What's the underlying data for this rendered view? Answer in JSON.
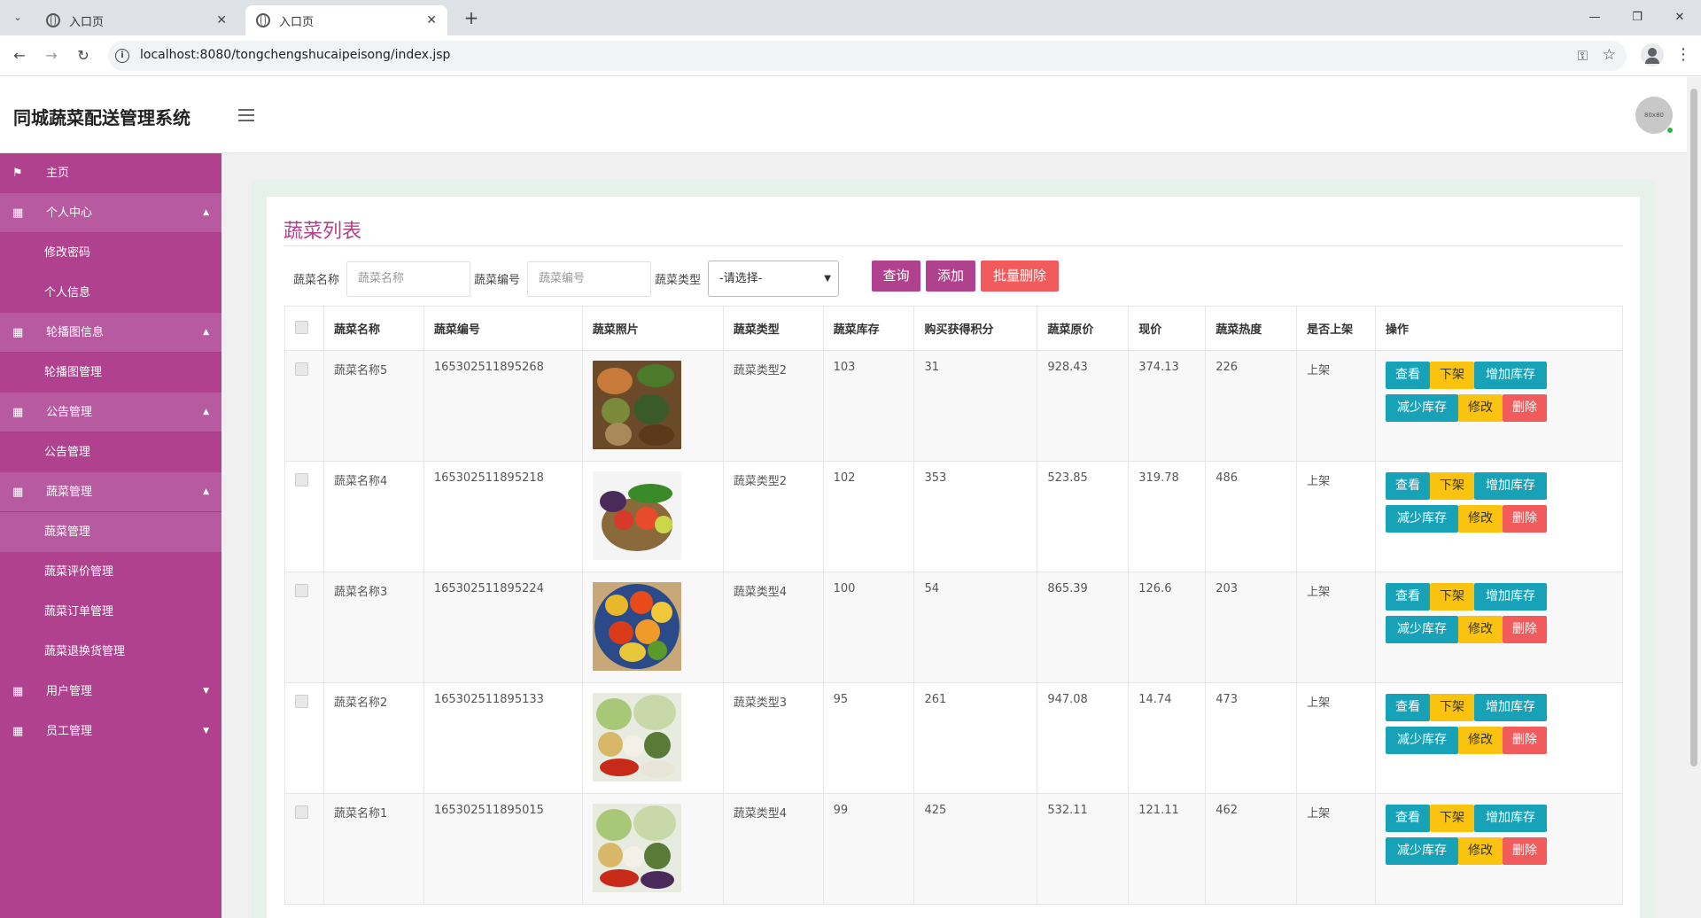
{
  "browser": {
    "tabs": [
      {
        "title": "入口页",
        "active": false
      },
      {
        "title": "入口页",
        "active": true
      }
    ],
    "url": "localhost:8080/tongchengshucaipeisong/index.jsp"
  },
  "header": {
    "title": "同城蔬菜配送管理系统",
    "avatar_text": "80x80"
  },
  "sidebar": {
    "home": "主页",
    "groups": [
      {
        "label": "个人中心",
        "items": [
          "修改密码",
          "个人信息"
        ]
      },
      {
        "label": "轮播图信息",
        "items": [
          "轮播图管理"
        ]
      },
      {
        "label": "公告管理",
        "items": [
          "公告管理"
        ]
      },
      {
        "label": "蔬菜管理",
        "items": [
          "蔬菜管理",
          "蔬菜评价管理",
          "蔬菜订单管理",
          "蔬菜退换货管理"
        ]
      },
      {
        "label": "用户管理",
        "items": []
      },
      {
        "label": "员工管理",
        "items": []
      }
    ]
  },
  "main": {
    "title": "蔬菜列表",
    "filters": {
      "name_label": "蔬菜名称",
      "name_placeholder": "蔬菜名称",
      "code_label": "蔬菜编号",
      "code_placeholder": "蔬菜编号",
      "type_label": "蔬菜类型",
      "type_selected": "-请选择-"
    },
    "buttons": {
      "search": "查询",
      "add": "添加",
      "batch_delete": "批量删除"
    },
    "colors": {
      "search": "#b0418e",
      "add": "#b0418e",
      "batch_delete": "#f15b5b"
    },
    "table": {
      "headers": [
        "蔬菜名称",
        "蔬菜编号",
        "蔬菜照片",
        "蔬菜类型",
        "蔬菜库存",
        "购买获得积分",
        "蔬菜原价",
        "现价",
        "蔬菜热度",
        "是否上架",
        "操作"
      ],
      "rows": [
        {
          "name": "蔬菜名称5",
          "code": "165302511895268",
          "type": "蔬菜类型2",
          "stock": "103",
          "points": "31",
          "orig": "928.43",
          "price": "374.13",
          "heat": "226",
          "status": "上架"
        },
        {
          "name": "蔬菜名称4",
          "code": "165302511895218",
          "type": "蔬菜类型2",
          "stock": "102",
          "points": "353",
          "orig": "523.85",
          "price": "319.78",
          "heat": "486",
          "status": "上架"
        },
        {
          "name": "蔬菜名称3",
          "code": "165302511895224",
          "type": "蔬菜类型4",
          "stock": "100",
          "points": "54",
          "orig": "865.39",
          "price": "126.6",
          "heat": "203",
          "status": "上架"
        },
        {
          "name": "蔬菜名称2",
          "code": "165302511895133",
          "type": "蔬菜类型3",
          "stock": "95",
          "points": "261",
          "orig": "947.08",
          "price": "14.74",
          "heat": "473",
          "status": "上架"
        },
        {
          "name": "蔬菜名称1",
          "code": "165302511895015",
          "type": "蔬菜类型4",
          "stock": "99",
          "points": "425",
          "orig": "532.11",
          "price": "121.11",
          "heat": "462",
          "status": "上架"
        }
      ],
      "actions": {
        "view": "查看",
        "unlist": "下架",
        "add_stock": "增加库存",
        "reduce_stock": "减少库存",
        "edit": "修改",
        "delete": "删除"
      }
    }
  }
}
